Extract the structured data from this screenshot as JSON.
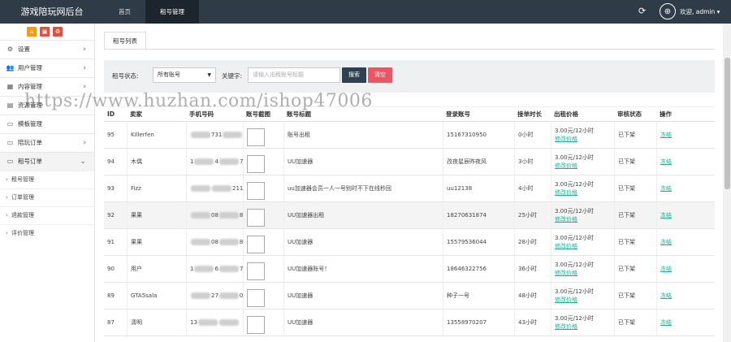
{
  "header": {
    "brand": "游戏陪玩网后台",
    "nav": [
      {
        "label": "首页"
      },
      {
        "label": "租号管理"
      }
    ],
    "user": "欢迎, admin ▾",
    "refresh_icon": "refresh-icon",
    "avatar_icon": "user-avatar-icon"
  },
  "sidebar": {
    "quick_buttons": [
      {
        "icon": "home-icon",
        "glyph": "⌂",
        "color": "#f39c12"
      },
      {
        "icon": "delete-icon",
        "glyph": "▣",
        "color": "#e74c3c"
      },
      {
        "icon": "refresh-icon",
        "glyph": "♻",
        "color": "#e74c3c"
      }
    ],
    "items": [
      {
        "label": "设置",
        "icon": "gear-icon",
        "glyph": "⚙",
        "chevron": "›"
      },
      {
        "label": "用户管理",
        "icon": "users-icon",
        "glyph": "👥",
        "chevron": "›"
      },
      {
        "label": "内容管理",
        "icon": "grid-icon",
        "glyph": "▦",
        "chevron": "›"
      },
      {
        "label": "资源管理",
        "icon": "folder-icon",
        "glyph": "▤",
        "chevron": ""
      },
      {
        "label": "模板管理",
        "icon": "template-icon",
        "glyph": "▭",
        "chevron": ""
      },
      {
        "label": "陪玩订单",
        "icon": "monitor-icon",
        "glyph": "▭",
        "chevron": "›"
      },
      {
        "label": "租号订单",
        "icon": "monitor-icon",
        "glyph": "▭",
        "chevron": "⌄"
      }
    ],
    "sub_items": [
      {
        "label": "租号管理"
      },
      {
        "label": "订单管理"
      },
      {
        "label": "退款管理"
      },
      {
        "label": "评价管理"
      }
    ]
  },
  "main": {
    "tab": "租号列表",
    "filter": {
      "status_label": "租号状态:",
      "status_value": "所有账号",
      "keyword_label": "关键字:",
      "keyword_placeholder": "请输入出租账号标题",
      "search_label": "搜索",
      "clear_label": "清空",
      "search_color": "#2f4050",
      "clear_color": "#ed5565"
    },
    "table": {
      "headers": [
        "ID",
        "卖家",
        "手机号码",
        "账号截图",
        "账号标题",
        "登录账号",
        "接单时长",
        "出租价格",
        "审核状态",
        "操作"
      ],
      "rows": [
        {
          "id": "95",
          "seller": "Killerfen",
          "phone_a": "",
          "phone_b": "731",
          "phone_c": "0",
          "title": "账号出租",
          "login": "15167310950",
          "duration": "0小时",
          "price": "3.00元/12小时",
          "edit": "修改价格",
          "status": "已下架",
          "action": "冻结"
        },
        {
          "id": "94",
          "seller": "木偶",
          "phone_a": "1",
          "phone_b": "4",
          "phone_c": "728",
          "title": "UU加速器",
          "login": "孜夜星辰昨夜风",
          "duration": "3小时",
          "price": "3.00元/12小时",
          "edit": "修改价格",
          "status": "已下架",
          "action": "冻结"
        },
        {
          "id": "93",
          "seller": "Fizz",
          "phone_a": "",
          "phone_b": "",
          "phone_c": "211",
          "title": "uu加速器会员一人一号别时不下在线秒回",
          "login": "uu12138",
          "duration": "4小时",
          "price": "3.00元/12小时",
          "edit": "修改价格",
          "status": "已下架",
          "action": "冻结"
        },
        {
          "id": "92",
          "seller": "果果",
          "phone_a": "",
          "phone_b": "08",
          "phone_c": "828",
          "title": "UU加速器出租",
          "login": "18270631874",
          "duration": "25小时",
          "price": "3.00元/12小时",
          "edit": "修改价格",
          "status": "已下架",
          "action": "冻结"
        },
        {
          "id": "91",
          "seller": "果果",
          "phone_a": "",
          "phone_b": "08",
          "phone_c": "828",
          "title": "UU加速器",
          "login": "15579536044",
          "duration": "28小时",
          "price": "3.00元/12小时",
          "edit": "修改价格",
          "status": "已下架",
          "action": "冻结"
        },
        {
          "id": "90",
          "seller": "用户",
          "phone_a": "1",
          "phone_b": "6",
          "phone_c": "756",
          "title": "UU加速器账号！",
          "login": "18646322756",
          "duration": "36小时",
          "price": "3.00元/12小时",
          "edit": "修改价格",
          "status": "已下架",
          "action": "冻结"
        },
        {
          "id": "89",
          "seller": "GTA5sala",
          "phone_a": "",
          "phone_b": "27",
          "phone_c": "078",
          "title": "UU加速器",
          "login": "种子一号",
          "duration": "48小时",
          "price": "3.00元/12小时",
          "edit": "修改价格",
          "status": "已下架",
          "action": "冻结"
        },
        {
          "id": "87",
          "seller": "清明",
          "phone_a": "13",
          "phone_b": "",
          "phone_c": "",
          "title": "UU加速器",
          "login": "13558970207",
          "duration": "43小时",
          "price": "3.00元/12小时",
          "edit": "修改价格",
          "status": "已下架",
          "action": "冻结"
        }
      ]
    }
  },
  "watermark": "https://www.huzhan.com/ishop47006"
}
